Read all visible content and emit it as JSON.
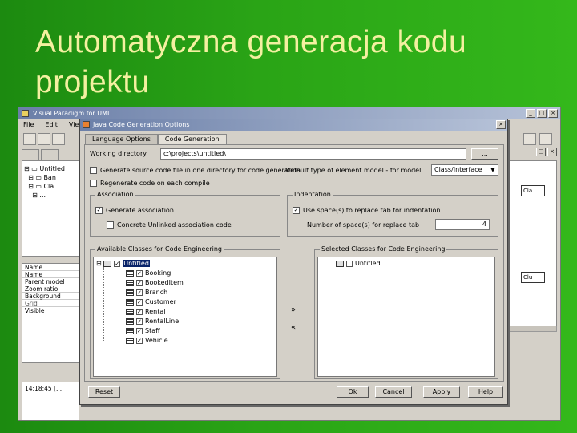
{
  "slide": {
    "title": "Automatyczna generacja kodu projektu"
  },
  "app": {
    "title": "Visual Paradigm for UML",
    "menu": [
      "File",
      "Edit",
      "View"
    ],
    "window_buttons": [
      "_",
      "□",
      "×"
    ]
  },
  "tree": {
    "items": [
      "Untitled",
      "Ban",
      "Cla",
      "..."
    ]
  },
  "properties": {
    "rows": [
      "Name",
      "Name",
      "Parent model",
      "Zoom ratio",
      "Background",
      "Grid",
      "Visible"
    ]
  },
  "log": {
    "text": "14:18:45 [..."
  },
  "canvas": {
    "class_labels": [
      "Cla",
      "Clu"
    ]
  },
  "dialog": {
    "title": "Java Code Generation Options",
    "close": "×",
    "tabs": [
      "Language Options",
      "Code Generation"
    ],
    "working_dir_label": "Working directory",
    "working_dir_value": "c:\\projects\\untitled\\",
    "browse_label": "...",
    "generate_single_label": "Generate source code file in one directory for code generation",
    "default_type_label": "Default type of element model - for model",
    "default_type_value": "Class/Interface",
    "regenerate_label": "Regenerate code on each compile",
    "association_title": "Association",
    "generate_association_label": "Generate association",
    "concrete_label": "Concrete Unlinked association code",
    "indentation_title": "Indentation",
    "use_spaces_label": "Use space(s) to replace tab for indentation",
    "spaces_count_label": "Number of space(s) for replace tab",
    "spaces_count_value": "4",
    "available_title": "Available Classes for Code Engineering",
    "selected_title": "Selected Classes for Code Engineering",
    "available_root": "Untitled",
    "available_items": [
      "Booking",
      "BookedItem",
      "Branch",
      "Customer",
      "Rental",
      "RentalLine",
      "Staff",
      "Vehicle"
    ],
    "selected_root": "Untitled",
    "move_right": "»",
    "move_left": "«",
    "reset_label": "Reset",
    "ok_label": "Ok",
    "cancel_label": "Cancel",
    "apply_label": "Apply",
    "help_label": "Help"
  }
}
